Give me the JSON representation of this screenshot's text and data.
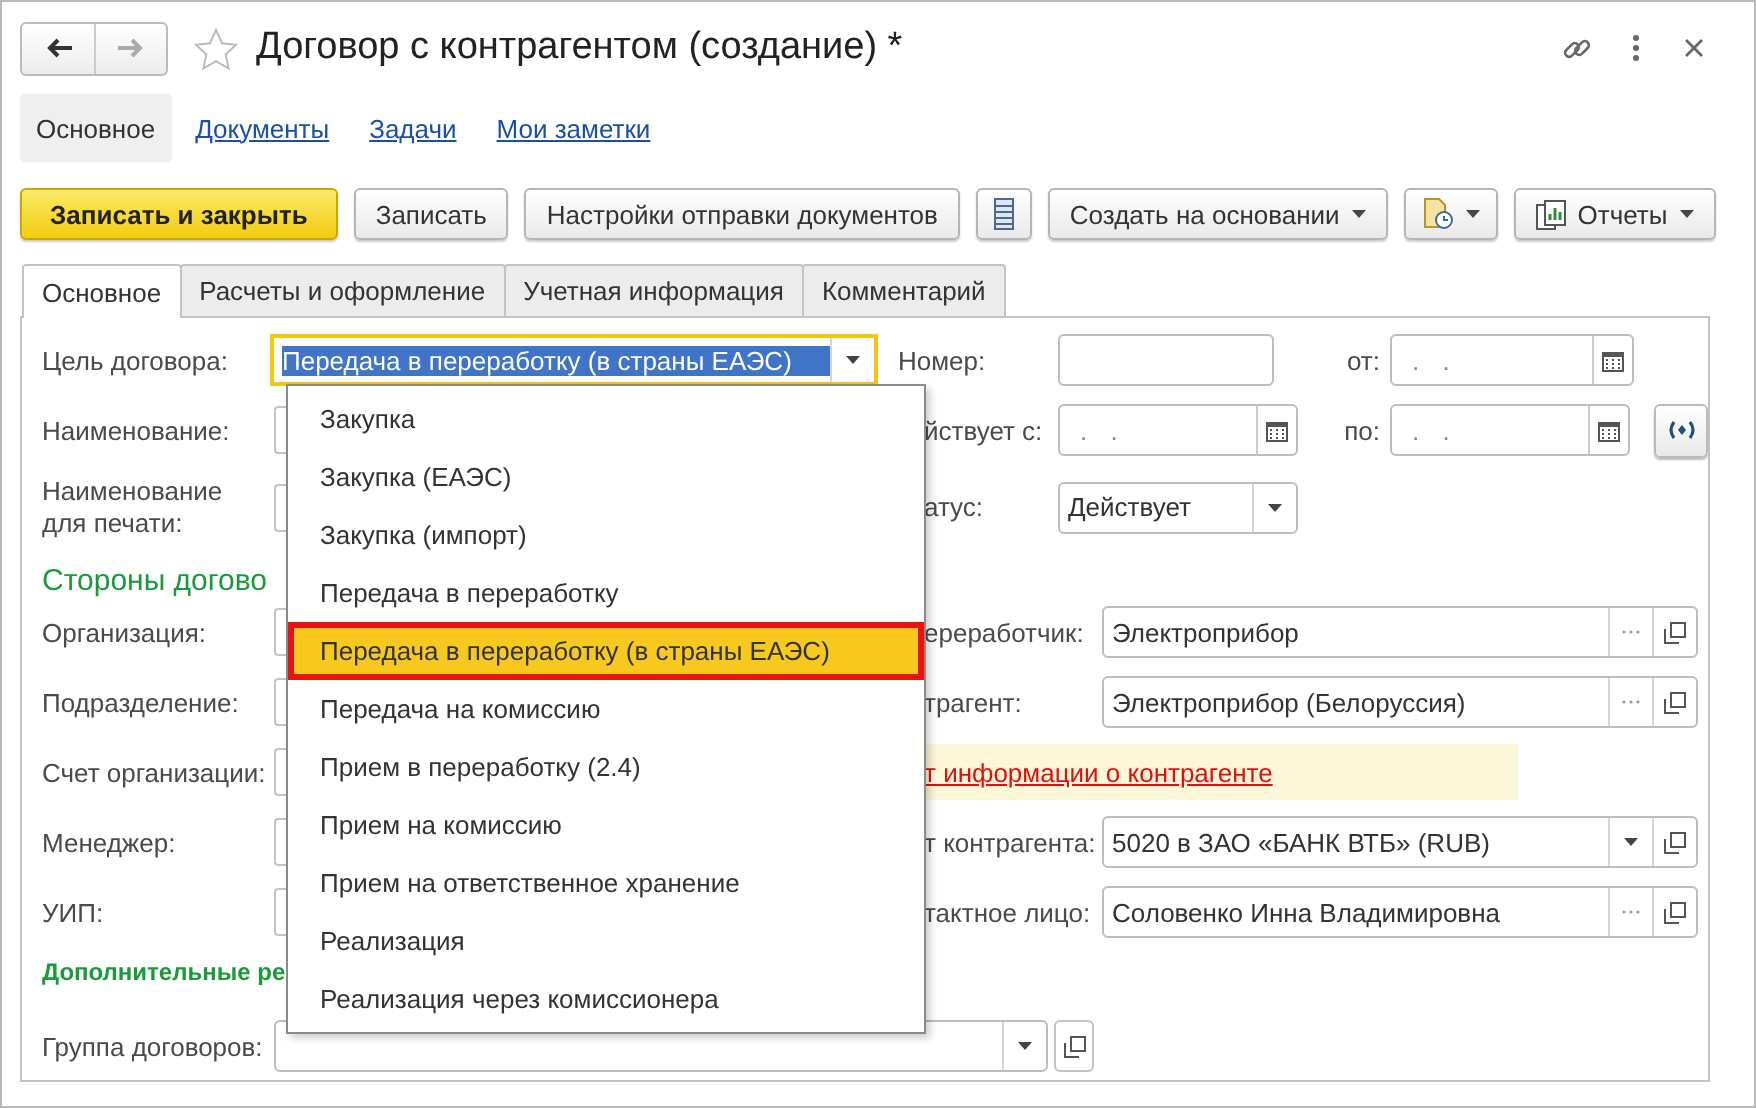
{
  "window": {
    "title": "Договор с контрагентом (создание) *"
  },
  "nav_tabs": [
    {
      "label": "Основное",
      "selected": true
    },
    {
      "label": "Документы",
      "selected": false
    },
    {
      "label": "Задачи",
      "selected": false
    },
    {
      "label": "Мои заметки",
      "selected": false
    }
  ],
  "toolbar": [
    {
      "kind": "primary",
      "label": "Записать и закрыть"
    },
    {
      "kind": "plain",
      "label": "Записать"
    },
    {
      "kind": "plain",
      "label": "Настройки отправки документов"
    },
    {
      "kind": "list"
    },
    {
      "kind": "menu",
      "label": "Создать на основании"
    },
    {
      "kind": "doc-menu"
    },
    {
      "kind": "reports",
      "label": "Отчеты"
    }
  ],
  "tabs": [
    {
      "label": "Основное",
      "selected": true
    },
    {
      "label": "Расчеты и оформление",
      "selected": false
    },
    {
      "label": "Учетная информация",
      "selected": false
    },
    {
      "label": "Комментарий",
      "selected": false
    }
  ],
  "form": {
    "purpose": {
      "label": "Цель договора:",
      "value": "Передача в переработку (в страны ЕАЭС)",
      "expanded": true
    },
    "number": {
      "label": "Номер:"
    },
    "dated": {
      "label": "от:",
      "placeholder": ". ."
    },
    "name": {
      "label": "Наименование:"
    },
    "valid_from": {
      "label": "йствует с:",
      "placeholder": ". ."
    },
    "valid_to": {
      "label": "по:",
      "placeholder": ". ."
    },
    "print_name": {
      "label": "Наименование для печати:"
    },
    "status": {
      "label": "атус:",
      "value": "Действует"
    },
    "parties_heading": "Стороны догово",
    "organization": {
      "label": "Организация:"
    },
    "processor": {
      "label": "ереработчик:",
      "value": "Электроприбор"
    },
    "department": {
      "label": "Подразделение:"
    },
    "counterparty": {
      "label": "трагент:",
      "value": "Электроприбор (Белоруссия)"
    },
    "org_account": {
      "label": "Счет организации:"
    },
    "counterparty_info_link": "т информации о контрагенте",
    "manager": {
      "label": "Менеджер:"
    },
    "counterparty_account": {
      "label": "т контрагента:",
      "value": "5020 в ЗАО «БАНК ВТБ» (RUB)"
    },
    "uip": {
      "label": "УИП:"
    },
    "contact": {
      "label": "тактное лицо:",
      "value": "Соловенко Инна Владимировна"
    },
    "extra_heading": "Дополнительные ре",
    "contract_group": {
      "label": "Группа договоров:"
    }
  },
  "dropdown": [
    {
      "label": "Закупка",
      "selected": false
    },
    {
      "label": "Закупка (ЕАЭС)",
      "selected": false
    },
    {
      "label": "Закупка (импорт)",
      "selected": false
    },
    {
      "label": "Передача в переработку",
      "selected": false
    },
    {
      "label": "Передача в переработку (в страны ЕАЭС)",
      "selected": true
    },
    {
      "label": "Передача на комиссию",
      "selected": false
    },
    {
      "label": "Прием в переработку (2.4)",
      "selected": false
    },
    {
      "label": "Прием на комиссию",
      "selected": false
    },
    {
      "label": "Прием на ответственное хранение",
      "selected": false
    },
    {
      "label": "Реализация",
      "selected": false
    },
    {
      "label": "Реализация через комиссионера",
      "selected": false
    }
  ]
}
